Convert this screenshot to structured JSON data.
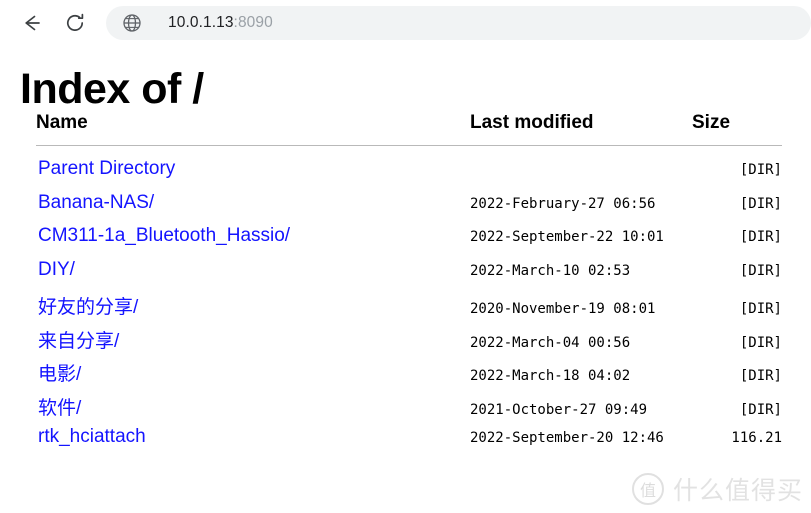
{
  "browser": {
    "back_icon": "back-arrow-icon",
    "reload_icon": "reload-icon",
    "site_icon": "globe-icon",
    "url_host": "10.0.1.13",
    "url_port": ":8090"
  },
  "page": {
    "title": "Index of /",
    "columns": {
      "name": "Name",
      "last_modified": "Last modified",
      "size": "Size"
    },
    "entries": [
      {
        "name": "Parent Directory",
        "modified": "",
        "size": "[DIR]"
      },
      {
        "name": "Banana-NAS/",
        "modified": "2022-February-27 06:56",
        "size": "[DIR]"
      },
      {
        "name": "CM311-1a_Bluetooth_Hassio/",
        "modified": "2022-September-22 10:01",
        "size": "[DIR]"
      },
      {
        "name": "DIY/",
        "modified": "2022-March-10 02:53",
        "size": "[DIR]"
      },
      {
        "name": "好友的分享/",
        "modified": "2020-November-19 08:01",
        "size": "[DIR]"
      },
      {
        "name": "来自分享/",
        "modified": "2022-March-04 00:56",
        "size": "[DIR]"
      },
      {
        "name": "电影/",
        "modified": "2022-March-18 04:02",
        "size": "[DIR]"
      },
      {
        "name": "软件/",
        "modified": "2021-October-27 09:49",
        "size": "[DIR]"
      },
      {
        "name": "rtk_hciattach",
        "modified": "2022-September-20 12:46",
        "size": "116.21"
      }
    ]
  },
  "watermark": {
    "badge": "值",
    "text": "什么值得买"
  },
  "colors": {
    "link": "#1414ff",
    "url_port": "#9aa0a6",
    "url_bar_bg": "#f1f3f4"
  }
}
